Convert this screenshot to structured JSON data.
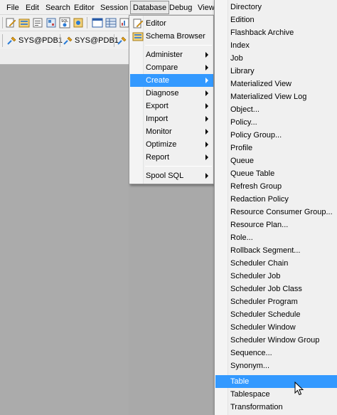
{
  "menubar": {
    "items": [
      "File",
      "Edit",
      "Search",
      "Editor",
      "Session",
      "Database",
      "Debug",
      "View"
    ],
    "active": "Database"
  },
  "toolbar": {
    "connections": [
      "SYS@PDB1",
      "SYS@PDB1"
    ]
  },
  "database_menu": {
    "items": [
      {
        "label": "Editor",
        "icon": "editor-icon"
      },
      {
        "label": "Schema Browser",
        "icon": "schema-browser-icon"
      },
      {
        "label": "Administer",
        "submenu": true
      },
      {
        "label": "Compare",
        "submenu": true
      },
      {
        "label": "Create",
        "submenu": true,
        "highlighted": true
      },
      {
        "label": "Diagnose",
        "submenu": true
      },
      {
        "label": "Export",
        "submenu": true
      },
      {
        "label": "Import",
        "submenu": true
      },
      {
        "label": "Monitor",
        "submenu": true
      },
      {
        "label": "Optimize",
        "submenu": true
      },
      {
        "label": "Report",
        "submenu": true
      },
      {
        "label": "Spool SQL",
        "submenu": true
      }
    ]
  },
  "create_submenu": {
    "items": [
      "Directory",
      "Edition",
      "Flashback Archive",
      "Index",
      "Job",
      "Library",
      "Materialized View",
      "Materialized View Log",
      "Object...",
      "Policy...",
      "Policy Group...",
      "Profile",
      "Queue",
      "Queue Table",
      "Refresh Group",
      "Redaction Policy",
      "Resource Consumer Group...",
      "Resource Plan...",
      "Role...",
      "Rollback Segment...",
      "Scheduler Chain",
      "Scheduler Job",
      "Scheduler Job Class",
      "Scheduler Program",
      "Scheduler Schedule",
      "Scheduler Window",
      "Scheduler Window Group",
      "Sequence...",
      "Synonym...",
      "Table",
      "Tablespace",
      "Transformation"
    ],
    "highlighted": "Table"
  },
  "colors": {
    "highlight": "#3399ff",
    "menu_bg": "#f0f0f0",
    "workspace": "#ababab"
  }
}
